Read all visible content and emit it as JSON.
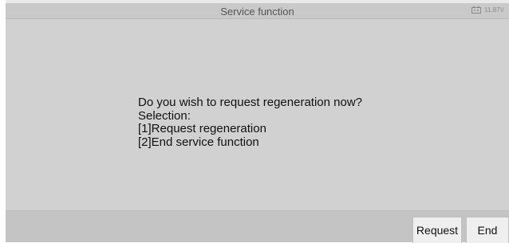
{
  "header": {
    "title": "Service function",
    "battery_voltage": "11.87V",
    "battery_icon": "battery-icon"
  },
  "dialog": {
    "lines": [
      "Do you wish to request regeneration now?",
      "Selection:",
      "[1]Request regeneration",
      "[2]End service function"
    ]
  },
  "footer": {
    "request_label": "Request",
    "end_label": "End"
  }
}
